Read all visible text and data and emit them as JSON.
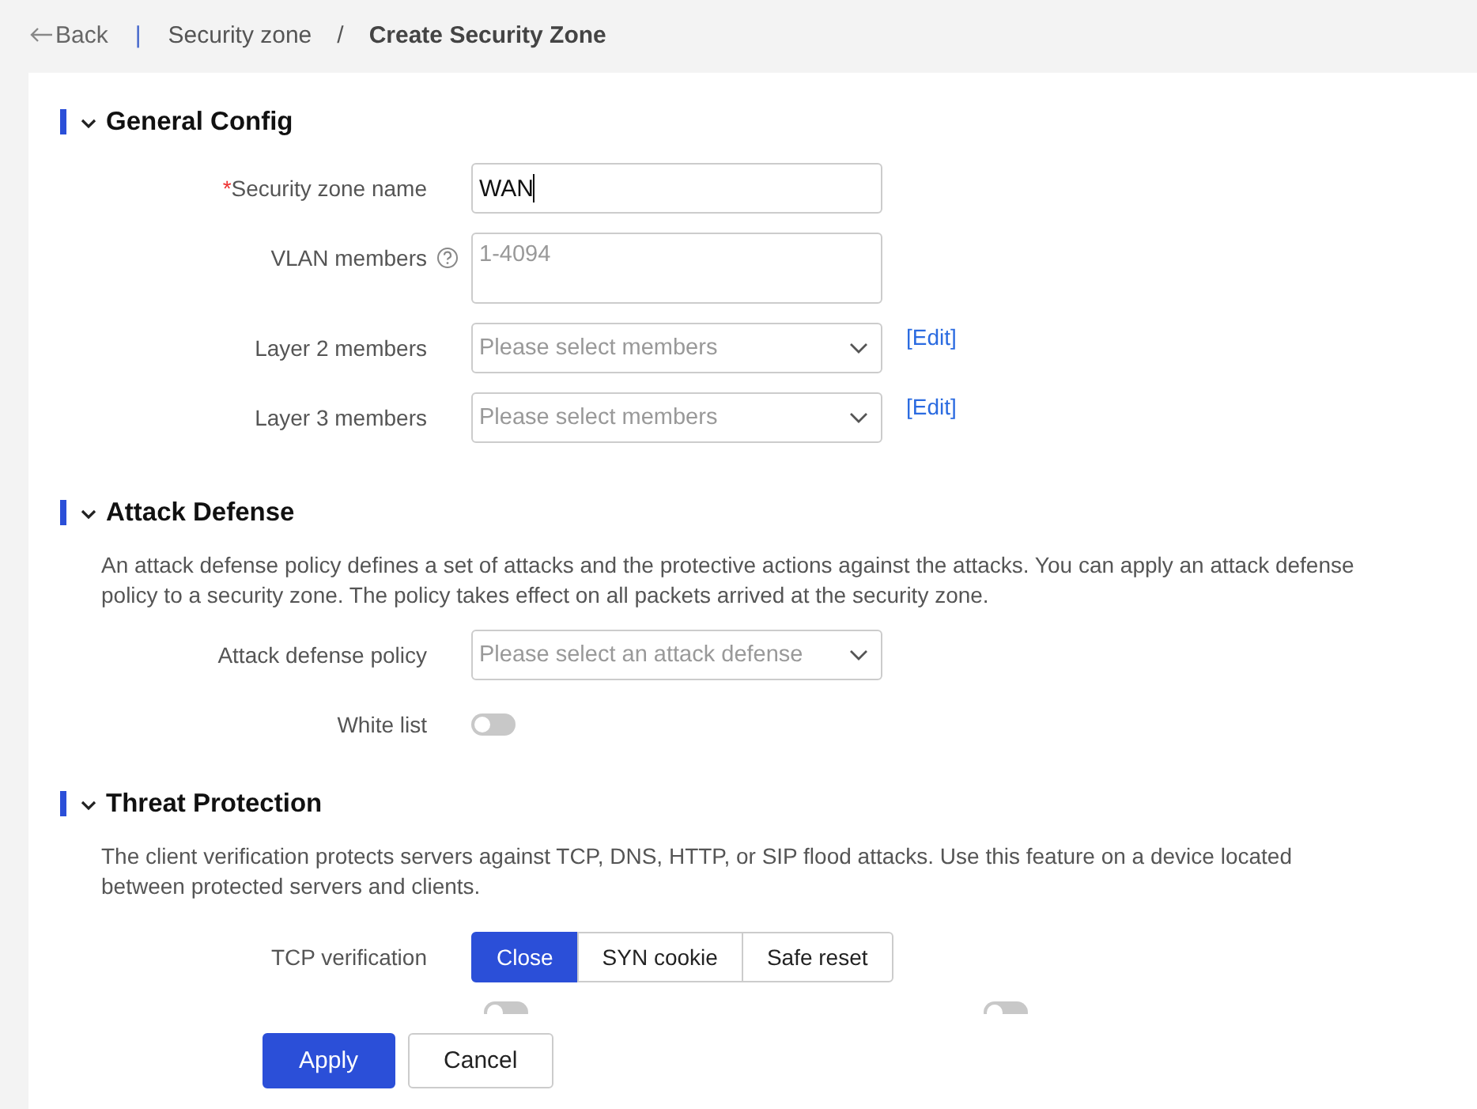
{
  "breadcrumb": {
    "back": "Back",
    "separator": "|",
    "parent": "Security zone",
    "slash": "/",
    "current": "Create Security Zone"
  },
  "sections": [
    {
      "title": "General Config",
      "expanded": true,
      "fields": [
        {
          "kind": "input",
          "label": "Security zone name",
          "required_mark": "*",
          "value": "WAN"
        },
        {
          "kind": "textarea",
          "label": "VLAN members",
          "help": true,
          "placeholder": "1-4094"
        },
        {
          "kind": "select",
          "label": "Layer 2 members",
          "placeholder": "Please select members",
          "link": "[Edit]"
        },
        {
          "kind": "select",
          "label": "Layer 3 members",
          "placeholder": "Please select members",
          "link": "[Edit]"
        }
      ]
    },
    {
      "title": "Attack Defense",
      "expanded": true,
      "description": "An attack defense policy defines a set of attacks and the protective actions against the attacks. You can apply an attack defense policy to a security zone. The policy takes effect on all packets arrived at the security zone.",
      "fields": [
        {
          "kind": "select",
          "label": "Attack defense policy",
          "placeholder": "Please select an attack defense"
        },
        {
          "kind": "switch",
          "label": "White list",
          "on": false
        }
      ]
    },
    {
      "title": "Threat Protection",
      "expanded": true,
      "description": "The client verification protects servers against TCP, DNS, HTTP, or SIP flood attacks. Use this feature on a device located between protected servers and clients.",
      "fields": [
        {
          "kind": "segmented",
          "label": "TCP verification",
          "options": [
            {
              "label": "Close",
              "selected": true
            },
            {
              "label": "SYN cookie",
              "selected": false
            },
            {
              "label": "Safe reset",
              "selected": false
            }
          ]
        },
        {
          "kind": "partial",
          "toggles": [
            {
              "on": false
            },
            {
              "on": false
            }
          ]
        }
      ]
    }
  ],
  "buttons": [
    {
      "label": "Apply",
      "kind": "primary"
    },
    {
      "label": "Cancel",
      "kind": "default"
    }
  ]
}
